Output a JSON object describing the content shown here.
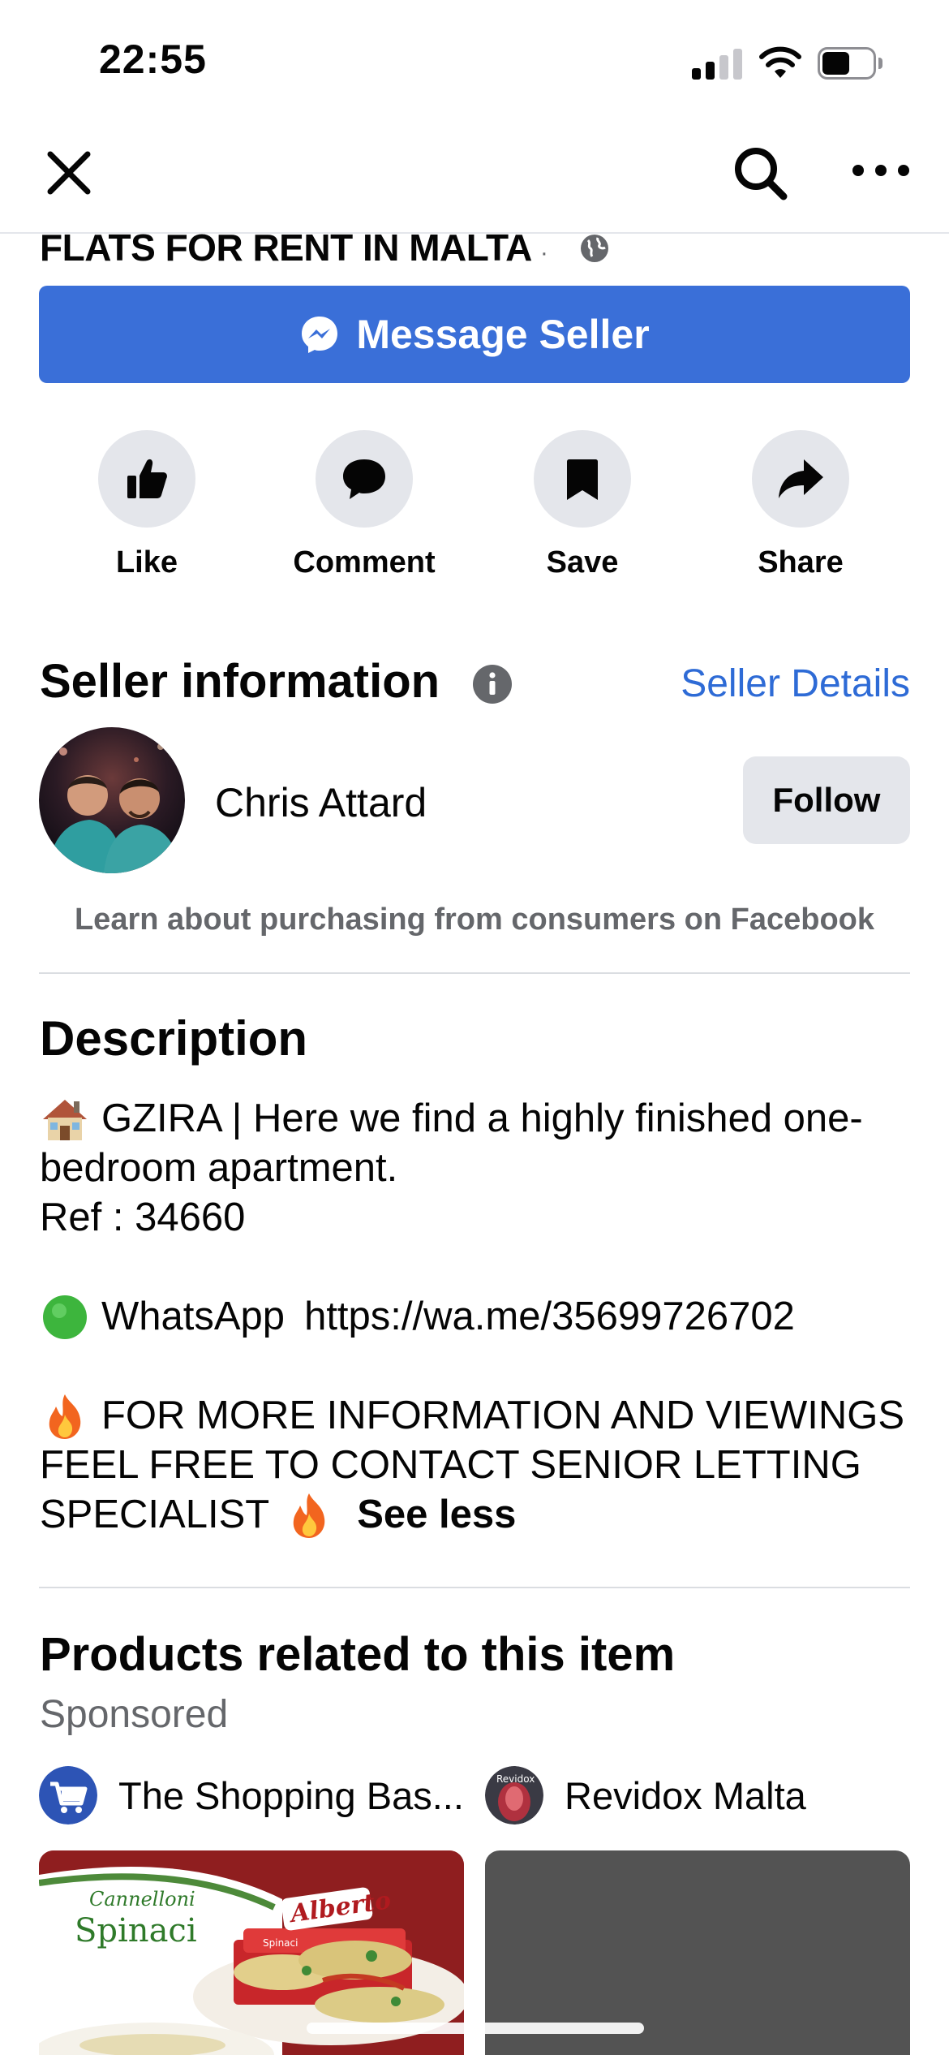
{
  "status_bar": {
    "time": "22:55",
    "battery_level": 0.55
  },
  "nav": {
    "close_icon": "close-icon",
    "search_icon": "search-icon",
    "more_icon": "more-icon"
  },
  "group": {
    "title": "FLATS FOR RENT IN MALTA",
    "separator": "·",
    "privacy_icon": "globe-icon"
  },
  "message_button": {
    "label": "Message Seller",
    "icon": "messenger-icon",
    "color": "#3a6fd8"
  },
  "actions": [
    {
      "label": "Like",
      "icon": "thumbs-up-icon"
    },
    {
      "label": "Comment",
      "icon": "comment-icon"
    },
    {
      "label": "Save",
      "icon": "bookmark-icon"
    },
    {
      "label": "Share",
      "icon": "share-icon"
    }
  ],
  "seller": {
    "heading": "Seller information",
    "details_link": "Seller Details",
    "name": "Chris Attard",
    "follow_label": "Follow",
    "learn_link": "Learn about purchasing from consumers on Facebook",
    "link_color": "#2e6bd6"
  },
  "description": {
    "heading": "Description",
    "line1": "GZIRA | Here we find a highly finished one-",
    "line2": "bedroom apartment.",
    "line3": "Ref : 34660",
    "whatsapp_label": "WhatsApp",
    "whatsapp_link": "https://wa.me/35699726702",
    "info_line1": "FOR MORE INFORMATION AND VIEWINGS",
    "info_line2": "FEEL FREE TO CONTACT SENIOR LETTING",
    "info_line3": "SPECIALIST",
    "see_less": "See less"
  },
  "products": {
    "heading": "Products related to this item",
    "sponsored": "Sponsored",
    "advertisers": [
      {
        "name": "The Shopping Bas...",
        "logo_icon": "shopping-cart-icon"
      },
      {
        "name": "Revidox Malta",
        "logo_text": "Revidox"
      }
    ],
    "card1": {
      "script": "Cannelloni",
      "title": "Spinaci",
      "brand": "Alberto",
      "pack_label": "Spinaci"
    }
  }
}
